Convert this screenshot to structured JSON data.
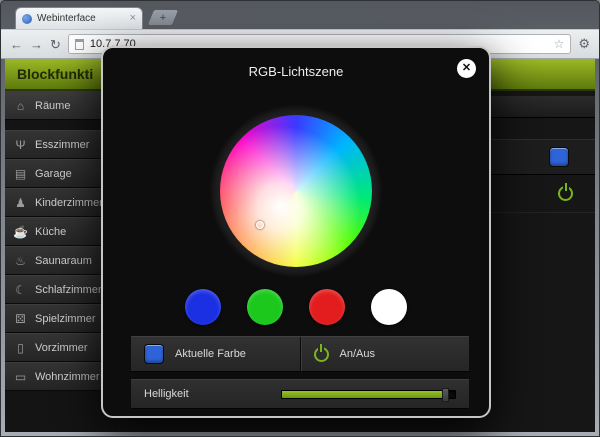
{
  "browser": {
    "tab_title": "Webinterface",
    "tab_close_glyph": "×",
    "new_tab_glyph": "+",
    "url": "10.7.7.70",
    "icons": {
      "back": "←",
      "forward": "→",
      "reload": "↻",
      "star": "☆",
      "menu": "⚙"
    }
  },
  "header": {
    "title": "Blockfunkti"
  },
  "sidebar": {
    "items": [
      {
        "label": "Räume",
        "icon": "home-icon",
        "glyph": "⌂"
      },
      {
        "label": "Esszimmer",
        "icon": "cutlery-icon",
        "glyph": "Ψ"
      },
      {
        "label": "Garage",
        "icon": "garage-icon",
        "glyph": "▤"
      },
      {
        "label": "Kinderzimmer",
        "icon": "toy-icon",
        "glyph": "♟"
      },
      {
        "label": "Küche",
        "icon": "kitchen-icon",
        "glyph": "☕"
      },
      {
        "label": "Saunaraum",
        "icon": "sauna-icon",
        "glyph": "♨"
      },
      {
        "label": "Schlafzimmer",
        "icon": "bed-icon",
        "glyph": "☾"
      },
      {
        "label": "Spielzimmer",
        "icon": "dice-icon",
        "glyph": "⚄"
      },
      {
        "label": "Vorzimmer",
        "icon": "door-icon",
        "glyph": "▯"
      },
      {
        "label": "Wohnzimmer",
        "icon": "sofa-icon",
        "glyph": "▭"
      }
    ]
  },
  "main": {
    "swatch_color": "#2f64d8",
    "power_color": "#7ab51d"
  },
  "modal": {
    "title": "RGB-Lichtszene",
    "close_glyph": "✕",
    "presets": [
      {
        "name": "blue",
        "color": "#1b2fe3"
      },
      {
        "name": "green",
        "color": "#1cc81c"
      },
      {
        "name": "red",
        "color": "#e31d1d"
      },
      {
        "name": "white",
        "color": "#ffffff"
      }
    ],
    "current": {
      "label": "Aktuelle Farbe",
      "color": "#2f64d8"
    },
    "power": {
      "label": "An/Aus",
      "color": "#7ab51d"
    },
    "brightness": {
      "label": "Helligkeit",
      "percent": 94,
      "fill_width": "94%"
    }
  }
}
